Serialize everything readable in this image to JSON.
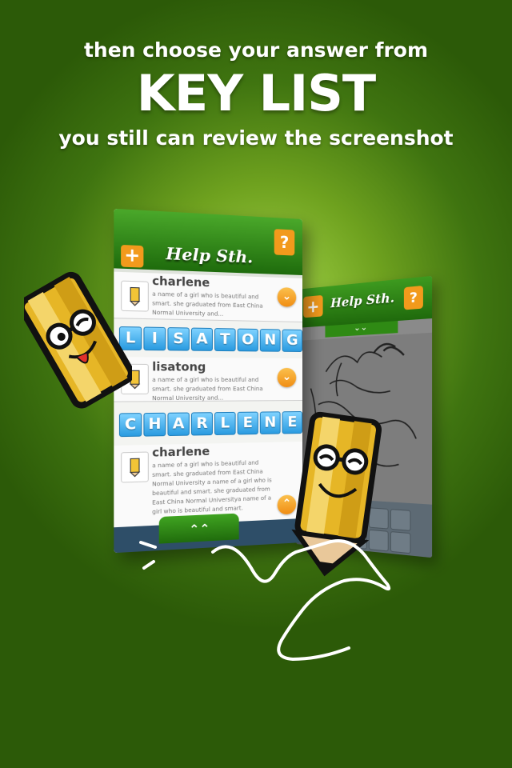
{
  "headline": {
    "line1": "then choose your answer from",
    "line2": "KEY LIST",
    "line3": "you still can review the screenshot"
  },
  "app": {
    "logo_text": "Help Sth.",
    "add_label": "+",
    "help_label": "?",
    "drawer_label": "⌃⌃"
  },
  "entries": [
    {
      "name": "charlene",
      "desc": "a name of a girl who is beautiful and smart. she graduated from East China Normal University and..."
    },
    {
      "name": "lisatong",
      "desc": "a name of a girl who is beautiful and smart. she graduated from East China Normal University and..."
    },
    {
      "name": "charlene",
      "desc": "a name of a girl who is beautiful and smart. she graduated from East China Normal University a name of a girl who is beautiful and smart. she graduated from East China Normal Universitya name of a girl who is beautiful and smart."
    }
  ],
  "tiles": {
    "row1": [
      "L",
      "I",
      "S",
      "A",
      "T",
      "O",
      "N",
      "G"
    ],
    "row2": [
      "C",
      "H",
      "A",
      "R",
      "L",
      "E",
      "N",
      "E"
    ]
  },
  "colors": {
    "accent_orange": "#f29a1c",
    "bar_green": "#2f8a14",
    "tile_blue": "#2a9be0"
  }
}
